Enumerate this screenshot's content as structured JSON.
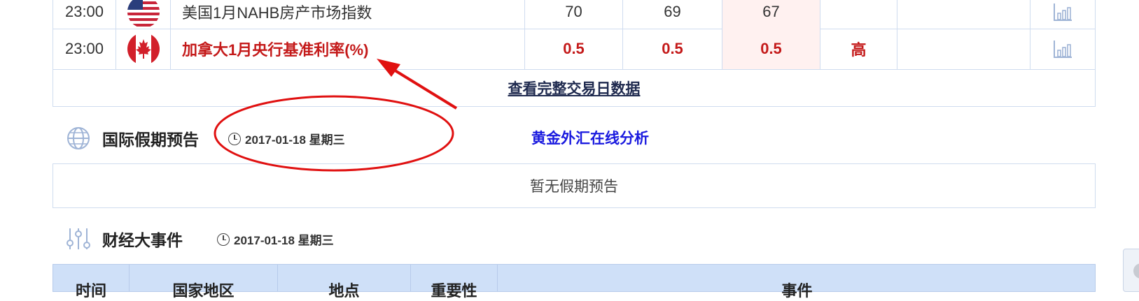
{
  "calendar_rows": [
    {
      "time": "23:00",
      "country": "United States",
      "flag_icon": "us-flag-icon",
      "event": "美国1月NAHB房产市场指数",
      "actual": "70",
      "forecast": "69",
      "previous": "67",
      "importance": "",
      "highlight": false
    },
    {
      "time": "23:00",
      "country": "Canada",
      "flag_icon": "canada-flag-icon",
      "event": "加拿大1月央行基准利率(%)",
      "actual": "0.5",
      "forecast": "0.5",
      "previous": "0.5",
      "importance": "高",
      "highlight": true
    }
  ],
  "full_data_link": "查看完整交易日数据",
  "holiday_section": {
    "title": "国际假期预告",
    "date": "2017-01-18 星期三",
    "online_link": "黄金外汇在线分析",
    "empty_text": "暂无假期预告"
  },
  "events_section": {
    "title": "财经大事件",
    "date": "2017-01-18 星期三",
    "columns": [
      "时间",
      "国家地区",
      "地点",
      "重要性",
      "事件"
    ]
  },
  "colors": {
    "accent_red": "#c41a1a",
    "annotation_red": "#e01010",
    "link_blue": "#1a1adf",
    "header_blue": "#cfe0f8"
  }
}
